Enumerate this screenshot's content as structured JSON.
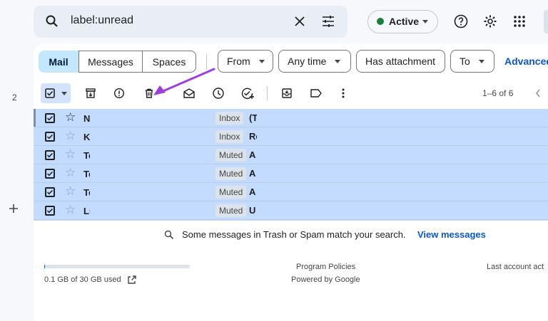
{
  "rail": {
    "number": "2"
  },
  "search": {
    "query": "label:unread"
  },
  "status": {
    "label": "Active",
    "color": "#188038"
  },
  "tabs": [
    {
      "label": "Mail",
      "selected": true
    },
    {
      "label": "Messages",
      "selected": false
    },
    {
      "label": "Spaces",
      "selected": false
    }
  ],
  "filters": {
    "from": "From",
    "any_time": "Any time",
    "has_attachment": "Has attachment",
    "to": "To",
    "advanced": "Advanced"
  },
  "toolbar": {
    "icons": [
      "select-all-checkbox-icon",
      "archive-icon",
      "report-spam-icon",
      "delete-icon",
      "mark-as-read-icon",
      "snooze-icon",
      "add-to-tasks-icon",
      "move-to-icon",
      "label-icon",
      "more-icon"
    ],
    "pager": "1–6 of 6"
  },
  "emails": [
    {
      "sender": "N",
      "label": "Inbox",
      "subject": "(Te",
      "starred_dark": true
    },
    {
      "sender": "K",
      "label": "Inbox",
      "subject": "Re",
      "starred_dark": false
    },
    {
      "sender": "Te",
      "label": "Muted",
      "subject": "A",
      "starred_dark": false
    },
    {
      "sender": "Te",
      "label": "Muted",
      "subject": "A",
      "starred_dark": false
    },
    {
      "sender": "Te",
      "label": "Muted",
      "subject": "A",
      "starred_dark": false
    },
    {
      "sender": "Lu",
      "label": "Muted",
      "subject": "U",
      "starred_dark": false
    }
  ],
  "notice": {
    "text": "Some messages in Trash or Spam match your search.",
    "link": "View messages"
  },
  "footer": {
    "storage": "0.1 GB of 30 GB used",
    "storage_fraction": 0.0033,
    "program_policies": "Program Policies",
    "powered_by": "Powered by Google",
    "last_activity": "Last account act"
  },
  "colors": {
    "accent": "#0b57d0",
    "selected_rows": "#c2dbff",
    "annotation_arrow": "#9b3fe0"
  }
}
